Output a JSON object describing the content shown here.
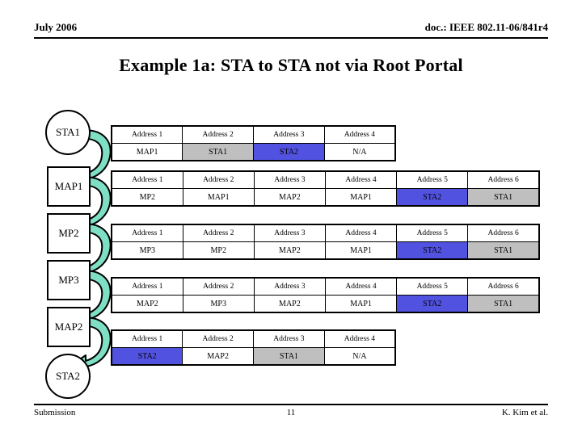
{
  "header": {
    "date": "July 2006",
    "doc_ref": "doc.: IEEE 802.11-06/841r4"
  },
  "title": "Example 1a: STA to STA not via Root Portal",
  "footer": {
    "left": "Submission",
    "page_number": "11",
    "right": "K. Kim et al."
  },
  "colors": {
    "arrow_fill": "#7fdfc4",
    "arrow_stroke": "#000000",
    "highlight_gray": "#bfbfbf",
    "highlight_blue": "#5252e0",
    "node_fill": "#ffffff",
    "node_stroke": "#000000"
  },
  "diagram": {
    "nodes": [
      {
        "label": "STA1",
        "shape": "circle"
      },
      {
        "label": "MAP1",
        "shape": "rect"
      },
      {
        "label": "MP2",
        "shape": "rect"
      },
      {
        "label": "MP3",
        "shape": "rect"
      },
      {
        "label": "MAP2",
        "shape": "rect"
      },
      {
        "label": "STA2",
        "shape": "circle"
      }
    ],
    "arrows": [
      {
        "from": "STA1",
        "to": "MAP1"
      },
      {
        "from": "MAP1",
        "to": "MP2"
      },
      {
        "from": "MP2",
        "to": "MP3"
      },
      {
        "from": "MP3",
        "to": "MAP2"
      },
      {
        "from": "MAP2",
        "to": "STA2"
      }
    ]
  },
  "tables": [
    {
      "id": "hop-1",
      "headers": [
        "Address 1",
        "Address 2",
        "Address 3",
        "Address 4"
      ],
      "values": [
        "MAP1",
        "STA1",
        "STA2",
        "N/A"
      ],
      "fills": [
        "none",
        "gray",
        "blue",
        "none"
      ]
    },
    {
      "id": "hop-2",
      "headers": [
        "Address 1",
        "Address 2",
        "Address 3",
        "Address 4",
        "Address 5",
        "Address 6"
      ],
      "values": [
        "MP2",
        "MAP1",
        "MAP2",
        "MAP1",
        "STA2",
        "STA1"
      ],
      "fills": [
        "none",
        "none",
        "none",
        "none",
        "blue",
        "gray"
      ]
    },
    {
      "id": "hop-3",
      "headers": [
        "Address 1",
        "Address 2",
        "Address 3",
        "Address 4",
        "Address 5",
        "Address 6"
      ],
      "values": [
        "MP3",
        "MP2",
        "MAP2",
        "MAP1",
        "STA2",
        "STA1"
      ],
      "fills": [
        "none",
        "none",
        "none",
        "none",
        "blue",
        "gray"
      ]
    },
    {
      "id": "hop-4",
      "headers": [
        "Address 1",
        "Address 2",
        "Address 3",
        "Address 4",
        "Address 5",
        "Address 6"
      ],
      "values": [
        "MAP2",
        "MP3",
        "MAP2",
        "MAP1",
        "STA2",
        "STA1"
      ],
      "fills": [
        "none",
        "none",
        "none",
        "none",
        "blue",
        "gray"
      ]
    },
    {
      "id": "hop-5",
      "headers": [
        "Address 1",
        "Address 2",
        "Address 3",
        "Address 4"
      ],
      "values": [
        "STA2",
        "MAP2",
        "STA1",
        "N/A"
      ],
      "fills": [
        "blue",
        "none",
        "gray",
        "none"
      ]
    }
  ]
}
